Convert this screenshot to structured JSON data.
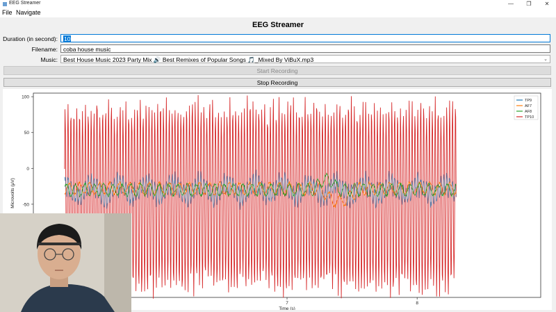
{
  "window": {
    "title": "EEG Streamer"
  },
  "menu": {
    "items": [
      "File",
      "Navigate"
    ]
  },
  "app": {
    "title": "EEG Streamer"
  },
  "form": {
    "duration_label": "Duration (in second):",
    "duration_value": "10",
    "filename_label": "Filename:",
    "filename_value": "coba house music",
    "music_label": "Music:",
    "music_value": "Best House Music 2023 Party Mix 🔊 Best Remixes of Popular Songs 🎵_Mixed By ViBuX.mp3"
  },
  "buttons": {
    "start": "Start Recording",
    "stop": "Stop Recording"
  },
  "chart_data": {
    "type": "line",
    "xlabel": "Time (s)",
    "ylabel": "Microvolts (μV)",
    "xlim": [
      5.05,
      8.95
    ],
    "ylim": [
      -180,
      105
    ],
    "x_ticks": [
      7,
      8
    ],
    "y_ticks": [
      100,
      50,
      0,
      -50
    ],
    "legend_position": "top-right",
    "series": [
      {
        "name": "TP9",
        "color": "#1f77b4",
        "baseline": -30,
        "amplitude": 12
      },
      {
        "name": "AF7",
        "color": "#ff7f0e",
        "baseline": -28,
        "amplitude": 8
      },
      {
        "name": "AF8",
        "color": "#2ca02c",
        "baseline": -30,
        "amplitude": 8
      },
      {
        "name": "TP10",
        "color": "#d62728",
        "baseline": -40,
        "amplitude": 130
      }
    ]
  },
  "colors": {
    "accent": "#0078d7",
    "tp10": "#b0303a",
    "tp9": "#3f5a98"
  }
}
